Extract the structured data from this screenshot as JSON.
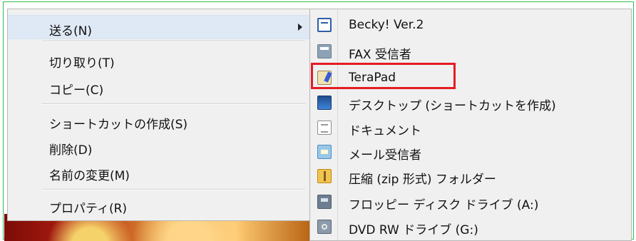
{
  "main_menu": {
    "items": [
      {
        "label": "送る(N)"
      },
      {
        "label": "切り取り(T)"
      },
      {
        "label": "コピー(C)"
      },
      {
        "label": "ショートカットの作成(S)"
      },
      {
        "label": "削除(D)"
      },
      {
        "label": "名前の変更(M)"
      },
      {
        "label": "プロパティ(R)"
      }
    ]
  },
  "submenu": {
    "items": [
      {
        "label": "Becky! Ver.2",
        "icon": "becky-icon"
      },
      {
        "label": "FAX 受信者",
        "icon": "fax-icon"
      },
      {
        "label": "TeraPad",
        "icon": "terapad-icon"
      },
      {
        "label": "デスクトップ (ショートカットを作成)",
        "icon": "desktop-icon"
      },
      {
        "label": "ドキュメント",
        "icon": "document-icon"
      },
      {
        "label": "メール受信者",
        "icon": "mail-icon"
      },
      {
        "label": "圧縮 (zip 形式) フォルダー",
        "icon": "zip-folder-icon"
      },
      {
        "label": "フロッピー ディスク ドライブ (A:)",
        "icon": "floppy-drive-icon"
      },
      {
        "label": "DVD RW ドライブ (G:)",
        "icon": "dvd-drive-icon"
      }
    ]
  },
  "colors": {
    "menu_bg": "#f0f0f0",
    "highlight_red": "#e61b23",
    "frame_green": "#2fbf4f"
  }
}
